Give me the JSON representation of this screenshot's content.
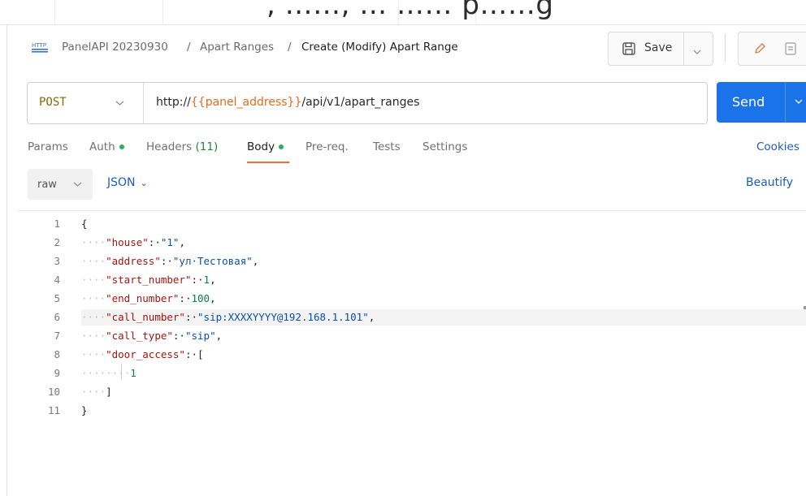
{
  "top_caption": ", ……, … …… p……g",
  "breadcrumb": {
    "method_badge": "HTTP",
    "collection": "PanelAPI 20230930",
    "sep": "/",
    "folder": "Apart Ranges",
    "request": "Create (Modify) Apart Range"
  },
  "save": {
    "label": "Save"
  },
  "request": {
    "method": "POST",
    "url_prefix": "http://",
    "url_var": "{{panel_address}}",
    "url_suffix": "/api/v1/apart_ranges",
    "send_label": "Send"
  },
  "tabs": {
    "params": "Params",
    "auth": "Auth",
    "headers": "Headers",
    "headers_count": "(11)",
    "body": "Body",
    "prereq": "Pre-req.",
    "tests": "Tests",
    "settings": "Settings",
    "cookies": "Cookies"
  },
  "body_toolbar": {
    "mode": "raw",
    "format": "JSON",
    "beautify": "Beautify"
  },
  "editor": {
    "line_numbers": [
      "1",
      "2",
      "3",
      "4",
      "5",
      "6",
      "7",
      "8",
      "9",
      "10",
      "11"
    ],
    "lines": {
      "l1": "{",
      "l2": {
        "ws": "····",
        "key": "\"house\"",
        "colon": ":·",
        "val": "\"1\"",
        "end": ","
      },
      "l3": {
        "ws": "····",
        "key": "\"address\"",
        "colon": ":·",
        "val": "\"ул·Тестовая\"",
        "end": ","
      },
      "l4": {
        "ws": "····",
        "key": "\"start_number\"",
        "colon": ":·",
        "val": "1",
        "end": ","
      },
      "l5": {
        "ws": "····",
        "key": "\"end_number\"",
        "colon": ":·",
        "val": "100",
        "end": ","
      },
      "l6": {
        "ws": "····",
        "key": "\"call_number\"",
        "colon": ":·",
        "val": "\"sip:XXXXYYYY@192.168.1.101\"",
        "end": ","
      },
      "l7": {
        "ws": "····",
        "key": "\"call_type\"",
        "colon": ":·",
        "val": "\"sip\"",
        "end": ","
      },
      "l8": {
        "ws": "····",
        "key": "\"door_access\"",
        "colon": ":·",
        "val": "["
      },
      "l9": {
        "ws": "········",
        "val": "1"
      },
      "l10": {
        "ws": "····",
        "val": "]"
      },
      "l11": "}"
    }
  },
  "colors": {
    "send": "#1a73e8",
    "active_tab_underline": "#f26b3a",
    "status_dot": "#1fb35a",
    "url_variable": "#e06c1f",
    "link": "#1a5bbf"
  },
  "icons": [
    "http-icon",
    "save-icon",
    "chevron-down-icon",
    "pencil-icon",
    "document-icon"
  ]
}
